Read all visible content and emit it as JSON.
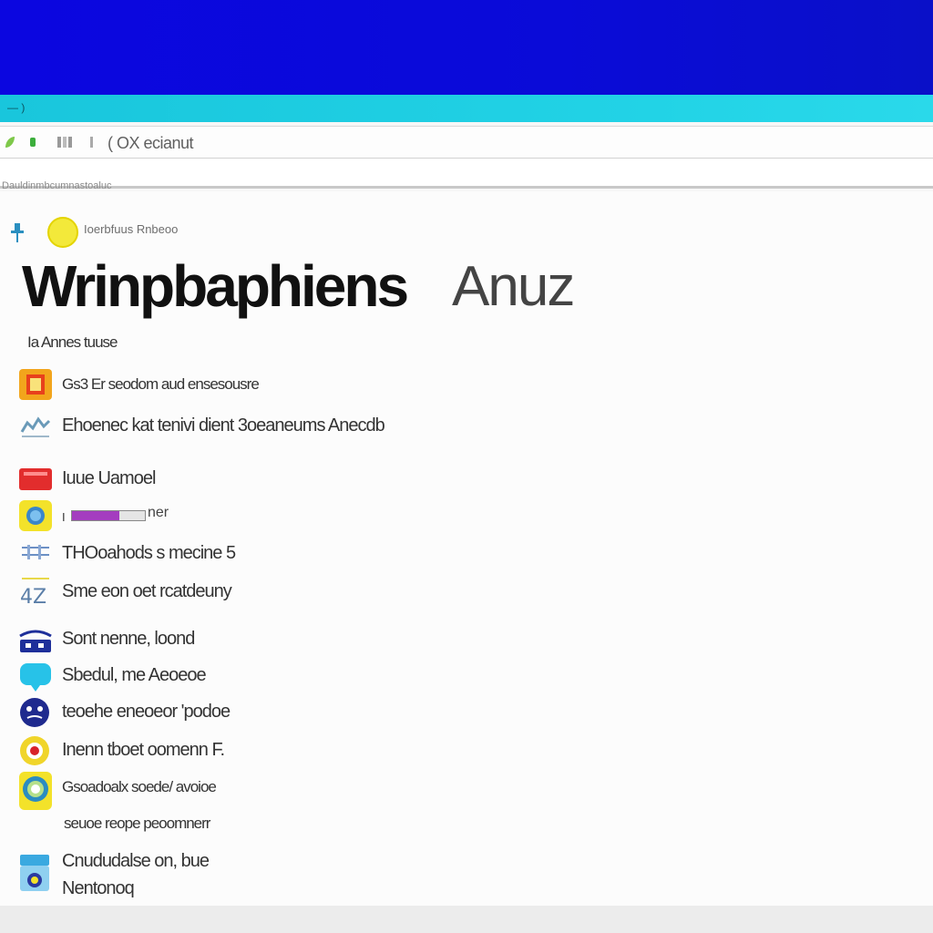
{
  "window": {
    "title_text": "— )",
    "toolbar_text": "( OX ecianut",
    "breadcrumb": "Dauldinmbcumnastoaluc"
  },
  "header": {
    "label": "Ioerbfuus Rnbeoo",
    "title": "Wrinpbaphiens",
    "title_tail": "Anuz",
    "subtitle": "Ia Annes tuuse"
  },
  "items": [
    {
      "label": "Gs3 Er seodom aud ensesousre",
      "icon": "document-icon",
      "color": "#f0a020"
    },
    {
      "label": "Ehoenec kat tenivi dient 3oeaneums Anecdb",
      "icon": "chart-icon",
      "color": "#6a9ab8"
    },
    {
      "label": "Iuue Uamoel",
      "icon": "card-icon",
      "color": "#e23030"
    },
    {
      "label": "ner",
      "icon": "chat-icon",
      "color": "#f2e32a",
      "progress": 0.65
    },
    {
      "label": "THOoahods s mecine 5",
      "icon": "grid-icon",
      "color": "#6b8fc4"
    },
    {
      "label": "Sme eon oet rcatdeuny",
      "icon": "tools-icon",
      "color": "#7aa0c8"
    },
    {
      "label": "Sont nenne, loond",
      "icon": "laptop-icon",
      "color": "#1e2f9a"
    },
    {
      "label": "Sbedul, me Aeoeoe",
      "icon": "message-icon",
      "color": "#27c2e8"
    },
    {
      "label": "teoehe eneoeor 'podoe",
      "icon": "face-icon",
      "color": "#1f2a8e"
    },
    {
      "label": "Inenn tboet oomenn F.",
      "icon": "record-icon",
      "color": "#f0d52a"
    },
    {
      "label": "Gsoadoalx soede/ avoioe",
      "sub": "seuoe reope peoomnerr",
      "icon": "sphere-icon",
      "color": "#2b8cc0"
    },
    {
      "label": "Cnududalse on, bue",
      "sub": "Nentonoq",
      "icon": "folder-icon",
      "color": "#3aa9e0"
    }
  ]
}
